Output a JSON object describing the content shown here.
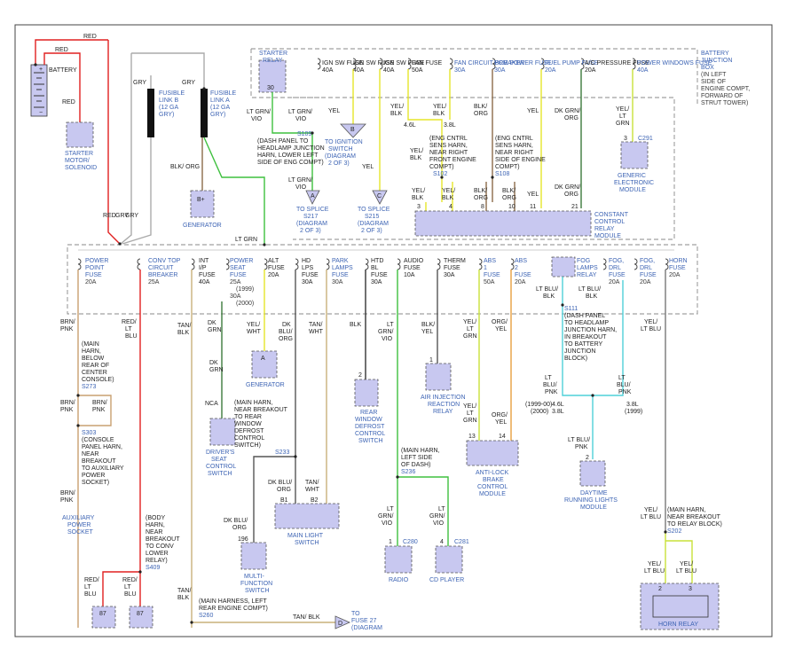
{
  "battery": {
    "label": "BATTERY",
    "plus": "+",
    "minus": "−"
  },
  "starter": {
    "name": "STARTER MOTOR/ SOLENOID"
  },
  "fusible_b": {
    "name": "FUSIBLE LINK B (12 GA GRY)"
  },
  "fusible_a": {
    "name": "FUSIBLE LINK A (12 GA GRY)"
  },
  "generator_top": {
    "pin": "B+",
    "name": "GENERATOR"
  },
  "generator_mid": {
    "pin": "A",
    "name": "GENERATOR"
  },
  "bjb": {
    "name": "BATTERY JUNCTION BOX (IN LEFT SIDE OF ENGINE COMPT, FORWARD OF STRUT TOWER)"
  },
  "starter_relay": {
    "name": "STARTER RELAY",
    "pin": "30"
  },
  "top_fuses": [
    {
      "id": "ign1",
      "label": "IGN SW FUSE",
      "amp": "40A"
    },
    {
      "id": "ign2",
      "label": "IGN SW FUSE",
      "amp": "40A"
    },
    {
      "id": "ign3",
      "label": "IGN SW FUSE",
      "amp": "40A"
    },
    {
      "id": "fan",
      "label": "FAN FUSE",
      "amp": "50A"
    },
    {
      "id": "fcb",
      "label": "FAN CIRCUIT BREAKER",
      "amp": "30A"
    },
    {
      "id": "pcm",
      "label": "PCM POWER FUSE",
      "amp": "30A"
    },
    {
      "id": "fuel",
      "label": "FUEL PUMP FUSE",
      "amp": "20A"
    },
    {
      "id": "ac",
      "label": "A/C PRESSURE FUSE",
      "amp": "20A"
    },
    {
      "id": "pw",
      "label": "POWER WINDOWS FUSE",
      "amp": "40A"
    }
  ],
  "bottom_fuses": [
    {
      "id": "pp",
      "label": "POWER POINT FUSE",
      "amp": "20A"
    },
    {
      "id": "ctcb",
      "label": "CONV TOP CIRCUIT BREAKER",
      "amp": "25A"
    },
    {
      "id": "int",
      "label": "INT I/P FUSE",
      "amp": "40A"
    },
    {
      "id": "seat",
      "label": "POWER SEAT FUSE",
      "amp": "25A",
      "extra": "(1999) 30A (2000)"
    },
    {
      "id": "alt",
      "label": "ALT FUSE",
      "amp": "20A"
    },
    {
      "id": "hd",
      "label": "HD LPS FUSE",
      "amp": "30A"
    },
    {
      "id": "park",
      "label": "PARK LAMPS FUSE",
      "amp": "30A"
    },
    {
      "id": "htd",
      "label": "HTD BL FUSE",
      "amp": "30A"
    },
    {
      "id": "audio",
      "label": "AUDIO FUSE",
      "amp": "10A"
    },
    {
      "id": "therm",
      "label": "THERM FUSE",
      "amp": "30A"
    },
    {
      "id": "abs1",
      "label": "ABS 1 FUSE",
      "amp": "50A"
    },
    {
      "id": "abs2",
      "label": "ABS 2 FUSE",
      "amp": "20A"
    },
    {
      "id": "fogdrl1",
      "label": "FOG, DRL FUSE",
      "amp": "20A"
    },
    {
      "id": "fogdrl2",
      "label": "FOG, DRL FUSE",
      "amp": "20A"
    },
    {
      "id": "horn",
      "label": "HORN FUSE",
      "amp": "20A"
    }
  ],
  "fog_relay": {
    "name": "FOG LAMPS RELAY"
  },
  "ccrm": {
    "name": "CONSTANT CONTROL RELAY MODULE"
  },
  "gem": {
    "name": "GENERIC ELECTRONIC MODULE",
    "conn": "C291",
    "pin": "3"
  },
  "splices": {
    "s109": "S109 (DASH PANEL TO HEADLAMP JUNCTION HARN, LOWER LEFT SIDE OF ENG COMPT)",
    "s102": "S102 (ENG CNTRL SENS HARN, NEAR RIGHT FRONT ENGINE COMPT)",
    "s108": "S108 (ENG CNTRL SENS HARN, NEAR RIGHT SIDE OF ENGINE COMPT)",
    "s111": "S111 (DASH PANEL TO HEADLAMP JUNCTION HARN, IN BREAKOUT TO BATTERY JUNCTION BLOCK)",
    "s273": "(MAIN HARN, BELOW REAR OF CENTER CONSOLE) S273",
    "s303": "S303 (CONSOLE PANEL HARN, NEAR BREAKOUT TO AUXILIARY POWER SOCKET)",
    "s409": "(BODY HARN, NEAR BREAKOUT TO CONV LOWER RELAY) S409",
    "s233": "(MAIN HARN, NEAR BREAKOUT TO REAR WINDOW DEFROST CONTROL SWITCH) S233",
    "s236": "(MAIN HARN, LEFT SIDE OF DASH) S236",
    "s202": "(MAIN HARN, NEAR BREAKOUT TO RELAY BLOCK) S202",
    "s260": "(MAIN HARNESS, LEFT REAR ENGINE COMPT) S260"
  },
  "refs": {
    "b": {
      "letter": "B",
      "text": "TO IGNITION SWITCH (DIAGRAM 2 OF 3)"
    },
    "a": {
      "letter": "A",
      "text": "TO SPLICE S217 (DIAGRAM 2 OF 3)"
    },
    "c": {
      "letter": "C",
      "text": "TO SPLICE S215 (DIAGRAM 2 OF 3)"
    },
    "d": {
      "letter": "D",
      "text": "TO FUSE 27 (DIAGRAM"
    }
  },
  "components": {
    "aux": "AUXILIARY POWER SOCKET",
    "seat": "DRIVER'S SEAT CONTROL SWITCH",
    "mfs": "MULTI- FUNCTION SWITCH",
    "mls": "MAIN LIGHT SWITCH",
    "rwd": "REAR WINDOW DEFROST CONTROL SWITCH",
    "radio": "RADIO",
    "cd": "CD PLAYER",
    "air": "AIR INJECTION REACTION RELAY",
    "abs": "ANTI-LOCK BRAKE CONTROL MODULE",
    "drl": "DAYTIME RUNNING LIGHTS MODULE",
    "horn": "HORN RELAY"
  },
  "wires": {
    "red": "RED",
    "gry": "GRY",
    "blkorg": "BLK/ ORG",
    "ltgrn": "LT GRN",
    "ltgrnvio": "LT GRN/ VIO",
    "yel": "YEL",
    "yelblk": "YEL/ BLK",
    "blkorg2": "BLK/ ORG",
    "dkgrnorg": "DK GRN/ ORG",
    "yelltgrn": "YEL/ LT GRN",
    "brnpnk": "BRN/ PNK",
    "redltblu": "RED/ LT BLU",
    "tanblk": "TAN/ BLK",
    "dkgrn": "DK GRN",
    "yelwht": "YEL/ WHT",
    "dkbluorg": "DK BLU/ ORG",
    "tanwht": "TAN/ WHT",
    "blk": "BLK",
    "blkyel": "BLK/ YEL",
    "orgyel": "ORG/ YEL",
    "ltblublk": "LT BLU/ BLK",
    "ltblupnk": "LT BLU/ PNK",
    "yelltblu": "YEL/ LT BLU",
    "nca": "NCA"
  },
  "misc": {
    "l46": "4.6L",
    "l38": "3.8L",
    "y9900": "(1999-00)",
    "y2000": "(2000)",
    "y1999": "(1999)",
    "c280": "C280",
    "c281": "C281"
  }
}
